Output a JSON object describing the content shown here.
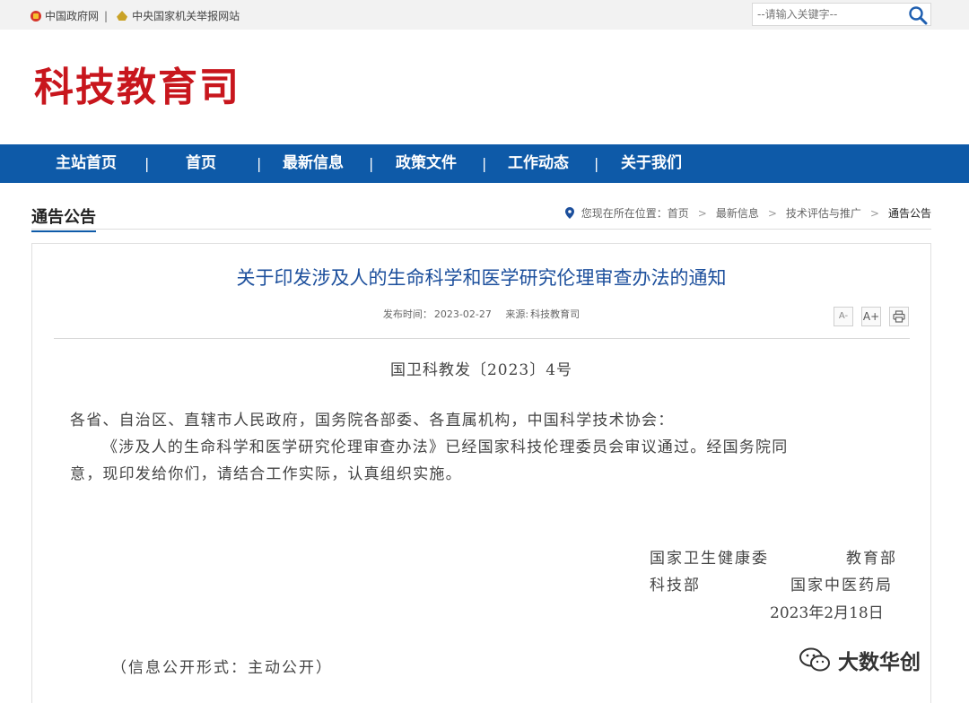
{
  "topbar": {
    "links": [
      {
        "label": "中国政府网"
      },
      {
        "label": "中央国家机关举报网站"
      }
    ],
    "separator": "|",
    "search_placeholder": "--请输入关键字--"
  },
  "site": {
    "title": "科技教育司"
  },
  "nav": {
    "items": [
      "主站首页",
      "首页",
      "最新信息",
      "政策文件",
      "工作动态",
      "关于我们"
    ],
    "separator": "|"
  },
  "section": {
    "title": "通告公告"
  },
  "breadcrumb": {
    "prefix": "您现在所在位置：",
    "items": [
      "首页",
      "最新信息",
      "技术评估与推广",
      "通告公告"
    ],
    "arrow": ">"
  },
  "article": {
    "title": "关于印发涉及人的生命科学和医学研究伦理审查办法的通知",
    "publish_label": "发布时间：",
    "publish_date": "2023-02-27",
    "source_label": "来源:",
    "source": "科技教育司",
    "tools": [
      "A-",
      "A+",
      "print"
    ],
    "doc_number": "国卫科教发〔2023〕4号",
    "salutation": "各省、自治区、直辖市人民政府，国务院各部委、各直属机构，中国科学技术协会：",
    "body_line1": "《涉及人的生命科学和医学研究伦理审查办法》已经国家科技伦理委员会审议通过。经国务院同",
    "body_line2": "意，现印发给你们，请结合工作实际，认真组织实施。",
    "signatories": [
      "国家卫生健康委",
      "教育部",
      "科技部",
      "国家中医药局"
    ],
    "sign_date": "2023年2月18日",
    "disclosure": "（信息公开形式：主动公开）"
  },
  "watermark": {
    "text": "大数华创"
  }
}
